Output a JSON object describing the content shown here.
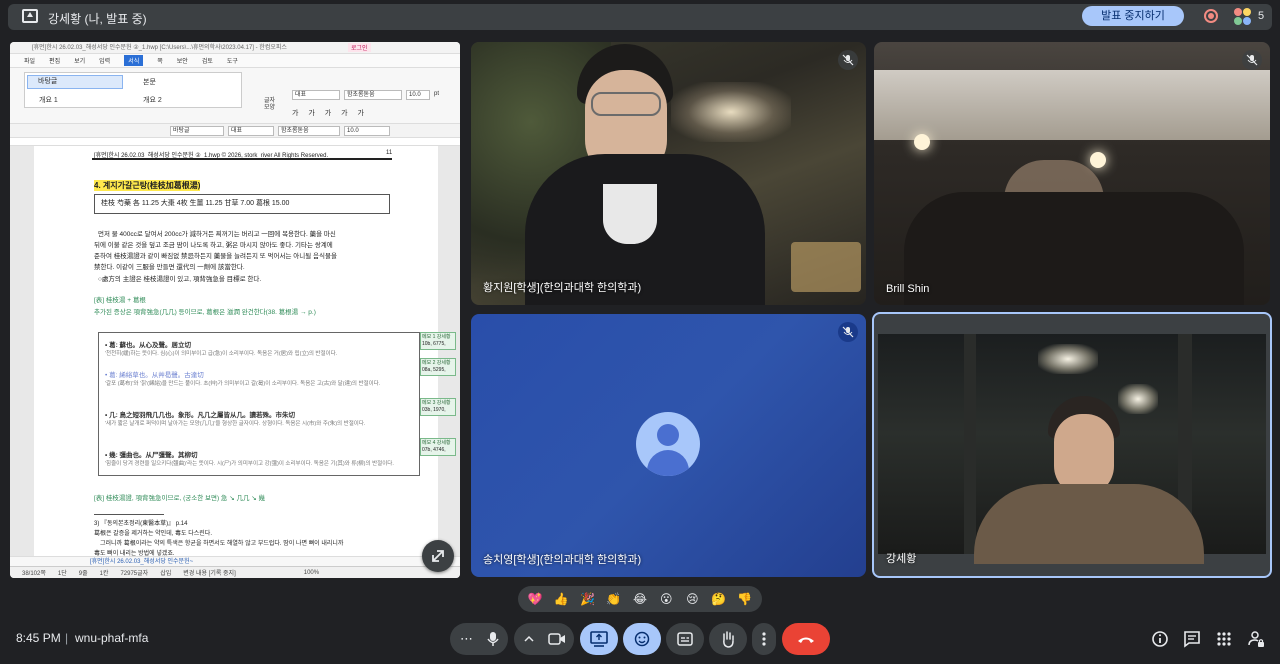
{
  "topbar": {
    "title": "강세황 (나, 발표 중)",
    "stop_presenting": "발표 중지하기",
    "participant_count": "5"
  },
  "document": {
    "window_title": "[휴먼]한시 26.02.03_해성서당 인수문헌 ②_1.hwp [C:\\Users\\...\\휴먼의학사\\2023.04.17] - 한컴오피스",
    "login_label": "로그인",
    "menu": [
      "파일",
      "편집",
      "보기",
      "입력",
      "서식",
      "쪽",
      "보안",
      "검토",
      "도구"
    ],
    "active_menu": "서식",
    "styles": {
      "s1": "바탕글",
      "s2": "본문",
      "s3": "개요 1",
      "s4": "개요 2",
      "para_label": "글자\n모양"
    },
    "font_style": "대표",
    "font_name": "함초롬돋움",
    "font_size": "10.0",
    "font_unit": "pt",
    "tb_style": "바탕글",
    "tb_font_style": "대표",
    "tb_font": "함초롬돋움",
    "tb_size": "10.0",
    "header_line": "[휴먼]한시 26.02.03_해성서당 인수문헌 ②_1.hwp © 2026, stork_river All Rights Reserved.",
    "page_number": "11",
    "heading": "4. 계지가갈근탕(桂枝加葛根湯)",
    "dose": "桂枝 芍藥 各 11.25 大棗 4枚 生薑 11.25 甘草 7.00 葛根 15.00",
    "para1": "먼저 물 400cc로 달여서 200cc가 減하거든 찌꺼기는 버리고 一回에 복용한다. 藥을 마신",
    "para2": "뒤에 이불 같은 것을 덮고 조금 땀이 나도록 하고, 粥은 마시지 않아도 좋다. 기타는 쌍계에",
    "para3": "준하여 桂枝湯證과 같이 빠짐없 禁忌하든지 藥물을 늘려든지 또 먹어서는 아니될 음식물을",
    "para4": "禁한다. 이같이 三服을 만들면 還代의 一劑에 該當한다.",
    "para5": "○處方의 主證은 桂枝湯證이 있고, 項背強急을 目標로 한다.",
    "note_head": "[表] 桂枝湯 + 葛根",
    "note_line": "추가된 증상은 項背強急(几几) 등이므로, 葛根은 滋潤 완건한다(38. 葛根湯 → p.)",
    "etym1_head": "• 葛: 蘇也。从心及聲。居立切",
    "etym1_body": "'천천히(緩)하는 뜻이다. 심(心)이 의미부이고 급(急)이 소리부이다. 독음은 거(居)와 립(立)의 반절이다.",
    "etym2_head": "• 葛: 絺綌草也。从艸曷聲。古達切",
    "etym2_body": "'갈포 (葛布)'와 '칡'(絺綌)을 만드는 풀이다. 초(艸)가 의미부이고 갈(曷)이 소리부이다. 독음은 고(古)와 달(達)의 반절이다.",
    "etym3_head": "• 几: 鳥之短羽飛几几也。象形。凡几之屬皆从几。讀若殊。市朱切",
    "etym3_body": "'새가 짧은 날개로 퍼덕이며 날아가는 모양(几几)'을 형상한 글자이다. 상형이다. 독음은 시(市)와 주(朱)의 반절이다.",
    "etym4_head": "• 幾: 彊曲也。从尸彊聲。其柳切",
    "etym4_body": "'힘줄이 당겨 경련을 일으키다(彊曲)'라는 뜻이다. 시(尸)가 의미부이고 강(彊)이 소리부이다. 독음은 기(其)와 류(柳)의 반절이다.",
    "comments": [
      {
        "label": "메모 1 강세황",
        "value": "10b, 6775,"
      },
      {
        "label": "메모 2 강세황",
        "value": "08a, 5295,"
      },
      {
        "label": "메모 3 강세황",
        "value": "03b, 1970,"
      },
      {
        "label": "메모 4 강세황",
        "value": "07b, 4746,"
      }
    ],
    "bottom_note": "[表] 桂枝湯證, 項背強急이므로, (궁소한 보면) 急 ↘ 几几 ↘ 幾",
    "ref_line": "3) 『동의본초정리(東醫本草)』 p.14",
    "ref1": "葛根은 갈증을 제거하는 약인데, 毒도 다스린다.",
    "ref2": "그러니까 葛根이라는 약의 특색은 항균을 하면서도 해열하 않고 부드럽다. 땀이 나면 뻐이 내리니까",
    "ref3": "毒도 뻐이 내리는 방법에 넣겠죠.",
    "tab_label": "[휴먼]한시 26.02.03_해성서당 인수문헌~",
    "status": [
      "38/102쪽",
      "1단",
      "9줄",
      "1칸",
      "72975글자",
      "삽입",
      "변경 내용 [기록 중지]"
    ],
    "zoom": "100%"
  },
  "participants": [
    {
      "name": "황지원[학생](한의과대학 한의학과)",
      "muted": true
    },
    {
      "name": "Brill Shin",
      "muted": true
    },
    {
      "name": "송치영[학생](한의과대학 한의학과)",
      "muted": true
    },
    {
      "name": "강세황",
      "muted": false
    }
  ],
  "reactions": [
    "💖",
    "👍",
    "🎉",
    "👏",
    "😂",
    "😮",
    "😢",
    "🤔",
    "👎"
  ],
  "bottombar": {
    "time": "8:45 PM",
    "separator": "|",
    "meeting_code": "wnu-phaf-mfa"
  },
  "colors": {
    "background": "#202124",
    "surface": "#3c4043",
    "accent_blue": "#a8c7fa",
    "end_call_red": "#ea4335",
    "avatar_tile": "#2f55ac"
  },
  "icons": [
    "present-icon",
    "record-icon",
    "people-icon",
    "mic-off-icon",
    "expand-icon",
    "more-icon",
    "mic-icon",
    "chevron-up-icon",
    "camera-icon",
    "present-screen-icon",
    "emoji-icon",
    "captions-icon",
    "raise-hand-icon",
    "more-vert-icon",
    "end-call-icon",
    "info-icon",
    "chat-icon",
    "activities-icon",
    "host-controls-icon"
  ]
}
